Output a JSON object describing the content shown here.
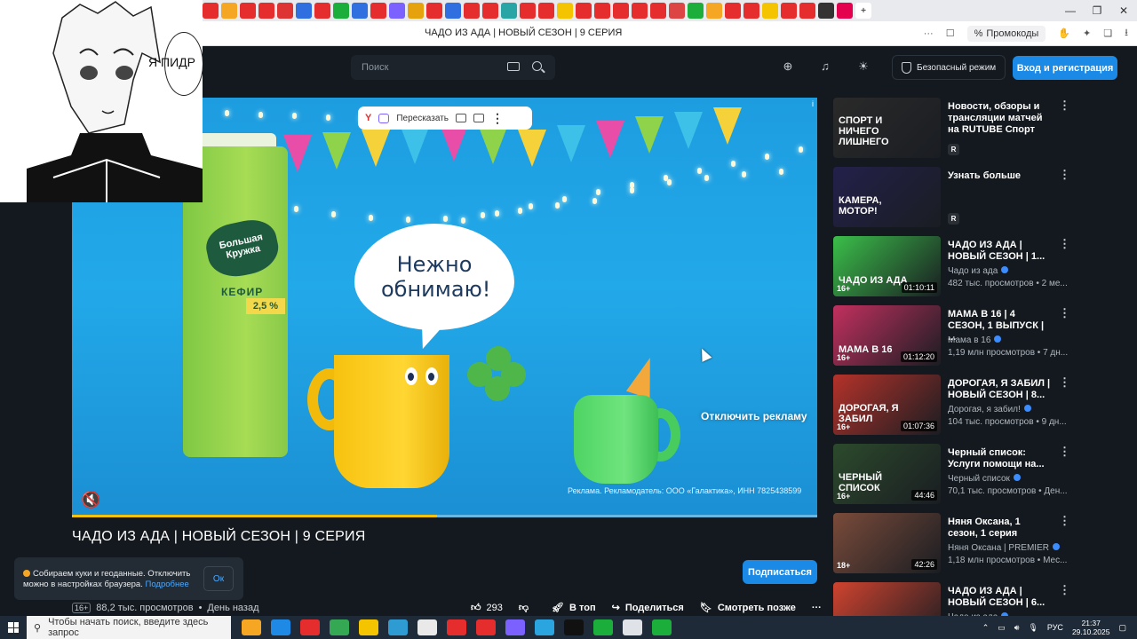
{
  "browser": {
    "page_title": "ЧАДО ИЗ АДА | НОВЫЙ СЕЗОН | 9 СЕРИЯ",
    "promo_label": "Промокоды",
    "tab_colors": [
      "#e52d2d",
      "#f5a623",
      "#e52d2d",
      "#e52d2d",
      "#d33",
      "#2f6fe0",
      "#e52d2d",
      "#1cae3b",
      "#2f6fe0",
      "#e52d2d",
      "#7b61ff",
      "#e5a20d",
      "#e52d2d",
      "#2f6fe0",
      "#e52d2d",
      "#e52d2d",
      "#2aa5a5",
      "#e52d2d",
      "#e52d2d",
      "#f5c400",
      "#e52d2d",
      "#e52d2d",
      "#e52d2d",
      "#e52d2d",
      "#e52d2d",
      "#d44",
      "#1cae3b",
      "#f5a623",
      "#e52d2d",
      "#e52d2d",
      "#f5c400",
      "#e52d2d",
      "#e52d2d",
      "#333",
      "#e5004f"
    ]
  },
  "header": {
    "search_placeholder": "Поиск",
    "safe_mode_label": "Безопасный режим",
    "login_label": "Вход и регистрация"
  },
  "overlay": {
    "manga_text": "Я ПИДР"
  },
  "player": {
    "toolbar_y": "Y",
    "toolbar_retell": "Пересказать",
    "ad_speech": "Нежно обнимаю!",
    "carton_brand": "Большая Кружка",
    "carton_product": "КЕФИР",
    "carton_fat": "2,5 %",
    "skip_ad_label": "Отключить рекламу",
    "ad_disclaimer": "Реклама. Рекламодатель: ООО «Галактика», ИНН 7825438599",
    "progress_percent": 49
  },
  "video": {
    "title": "ЧАДО ИЗ АДА | НОВЫЙ СЕЗОН | 9 СЕРИЯ",
    "age_rating": "16+",
    "views": "88,2 тыс. просмотров",
    "posted": "День назад",
    "likes": "293",
    "top_label": "В топ",
    "share_label": "Поделиться",
    "watch_later_label": "Смотреть позже",
    "subscribe_label": "Подписаться"
  },
  "cookie_banner": {
    "text": "Собираем куки и геоданные. Отключить можно в настройках браузера.",
    "link": "Подробнее",
    "ok_label": "Ок"
  },
  "sidebar": {
    "items": [
      {
        "title": "Новости, обзоры и трансляции матчей на RUTUBE Спорт",
        "channel": "",
        "views": "",
        "duration": "",
        "age": "",
        "thumb_text": "СПОРТ И НИЧЕГО ЛИШНЕГО",
        "thumb_color": "#2a2a2a",
        "badge": "R"
      },
      {
        "title": "Узнать больше",
        "channel": "",
        "views": "",
        "duration": "",
        "age": "",
        "thumb_text": "КАМЕРА, МОТОР!",
        "thumb_color": "#23204a",
        "badge": "R"
      },
      {
        "title": "ЧАДО ИЗ АДА | НОВЫЙ СЕЗОН | 1...",
        "channel": "Чадо из ада",
        "views": "482 тыс. просмотров • 2 ме...",
        "duration": "01:10:11",
        "age": "16+",
        "thumb_text": "ЧАДО ИЗ АДА",
        "thumb_color": "#3bbf4a",
        "badge": ""
      },
      {
        "title": "МАМА В 16 | 4 СЕЗОН, 1 ВЫПУСК | ...",
        "channel": "Мама в 16",
        "views": "1,19 млн просмотров • 7 дн...",
        "duration": "01:12:20",
        "age": "16+",
        "thumb_text": "МАМА В 16",
        "thumb_color": "#c2305f",
        "badge": ""
      },
      {
        "title": "ДОРОГАЯ, Я ЗАБИЛ | НОВЫЙ СЕЗОН | 8...",
        "channel": "Дорогая, я забил!",
        "views": "104 тыс. просмотров • 9 дн...",
        "duration": "01:07:36",
        "age": "16+",
        "thumb_text": "ДОРОГАЯ, Я ЗАБИЛ",
        "thumb_color": "#b5322a",
        "badge": ""
      },
      {
        "title": "Черный список: Услуги помощи на...",
        "channel": "Черный список",
        "views": "70,1 тыс. просмотров • Ден...",
        "duration": "44:46",
        "age": "16+",
        "thumb_text": "ЧЕРНЫЙ СПИСОК",
        "thumb_color": "#2c4a2c",
        "badge": ""
      },
      {
        "title": "Няня Оксана, 1 сезон, 1 серия",
        "channel": "Няня Оксана | PREMIER",
        "views": "1,18 млн просмотров • Мес...",
        "duration": "42:26",
        "age": "18+",
        "thumb_text": "",
        "thumb_color": "#7a4b3a",
        "badge": ""
      },
      {
        "title": "ЧАДО ИЗ АДА | НОВЫЙ СЕЗОН | 6...",
        "channel": "Чадо из ада",
        "views": "",
        "duration": "",
        "age": "",
        "thumb_text": "",
        "thumb_color": "#d0432f",
        "badge": ""
      }
    ]
  },
  "taskbar": {
    "search_placeholder": "Чтобы начать поиск, введите здесь запрос",
    "language": "РУС",
    "time": "21:37",
    "date": "29.10.2025",
    "app_colors": [
      "#f5a623",
      "#1e8ae6",
      "#e52d2d",
      "#34a853",
      "#f5c400",
      "#2f9bd3",
      "#e9e9e9",
      "#e52d2d",
      "#e52d2d",
      "#7b61ff",
      "#2aa5e0",
      "#111",
      "#1cae3b",
      "#dfe3e7",
      "#1cae3b"
    ]
  }
}
